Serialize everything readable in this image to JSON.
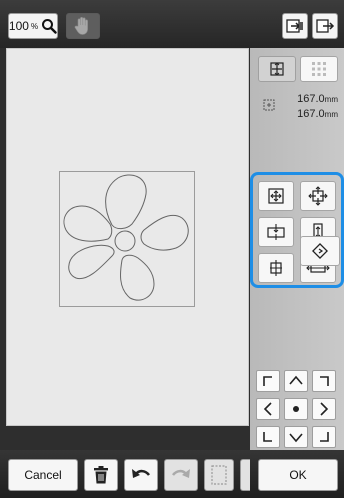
{
  "toolbar": {
    "zoom_value": "100",
    "zoom_unit": "%",
    "zoom_icon": "magnifier-icon",
    "hand_icon": "hand-pan-icon",
    "import_icon": "import-icon",
    "export_icon": "export-icon"
  },
  "panel": {
    "tab_single_icon": "single-pattern-icon",
    "tab_multi_icon": "multi-pattern-icon",
    "size": {
      "width_value": "167.0",
      "height_value": "167.0",
      "unit": "mm"
    },
    "move_group": {
      "icons": [
        "move-center-icon",
        "move-all-directions-icon",
        "move-horizontal-center-icon",
        "move-vertical-center-icon",
        "move-right-edge-icon",
        "move-horizontal-icon"
      ]
    },
    "rotate_icon": "rotate-icon",
    "dpad_icons": [
      "corner-top-left-icon",
      "arrow-up-icon",
      "corner-top-right-icon",
      "arrow-left-icon",
      "center-dot-icon",
      "arrow-right-icon",
      "corner-bottom-left-icon",
      "arrow-down-icon",
      "corner-bottom-right-icon"
    ]
  },
  "bottom": {
    "cancel_label": "Cancel",
    "ok_label": "OK",
    "delete_icon": "trash-icon",
    "undo_icon": "undo-icon",
    "redo_icon": "redo-icon",
    "select_icon": "dashed-selection-icon"
  },
  "colors": {
    "highlight": "#1e8ee6",
    "canvas": "#e9e9e9",
    "panel": "#c2c2c2",
    "bar": "#2e2e2e"
  }
}
